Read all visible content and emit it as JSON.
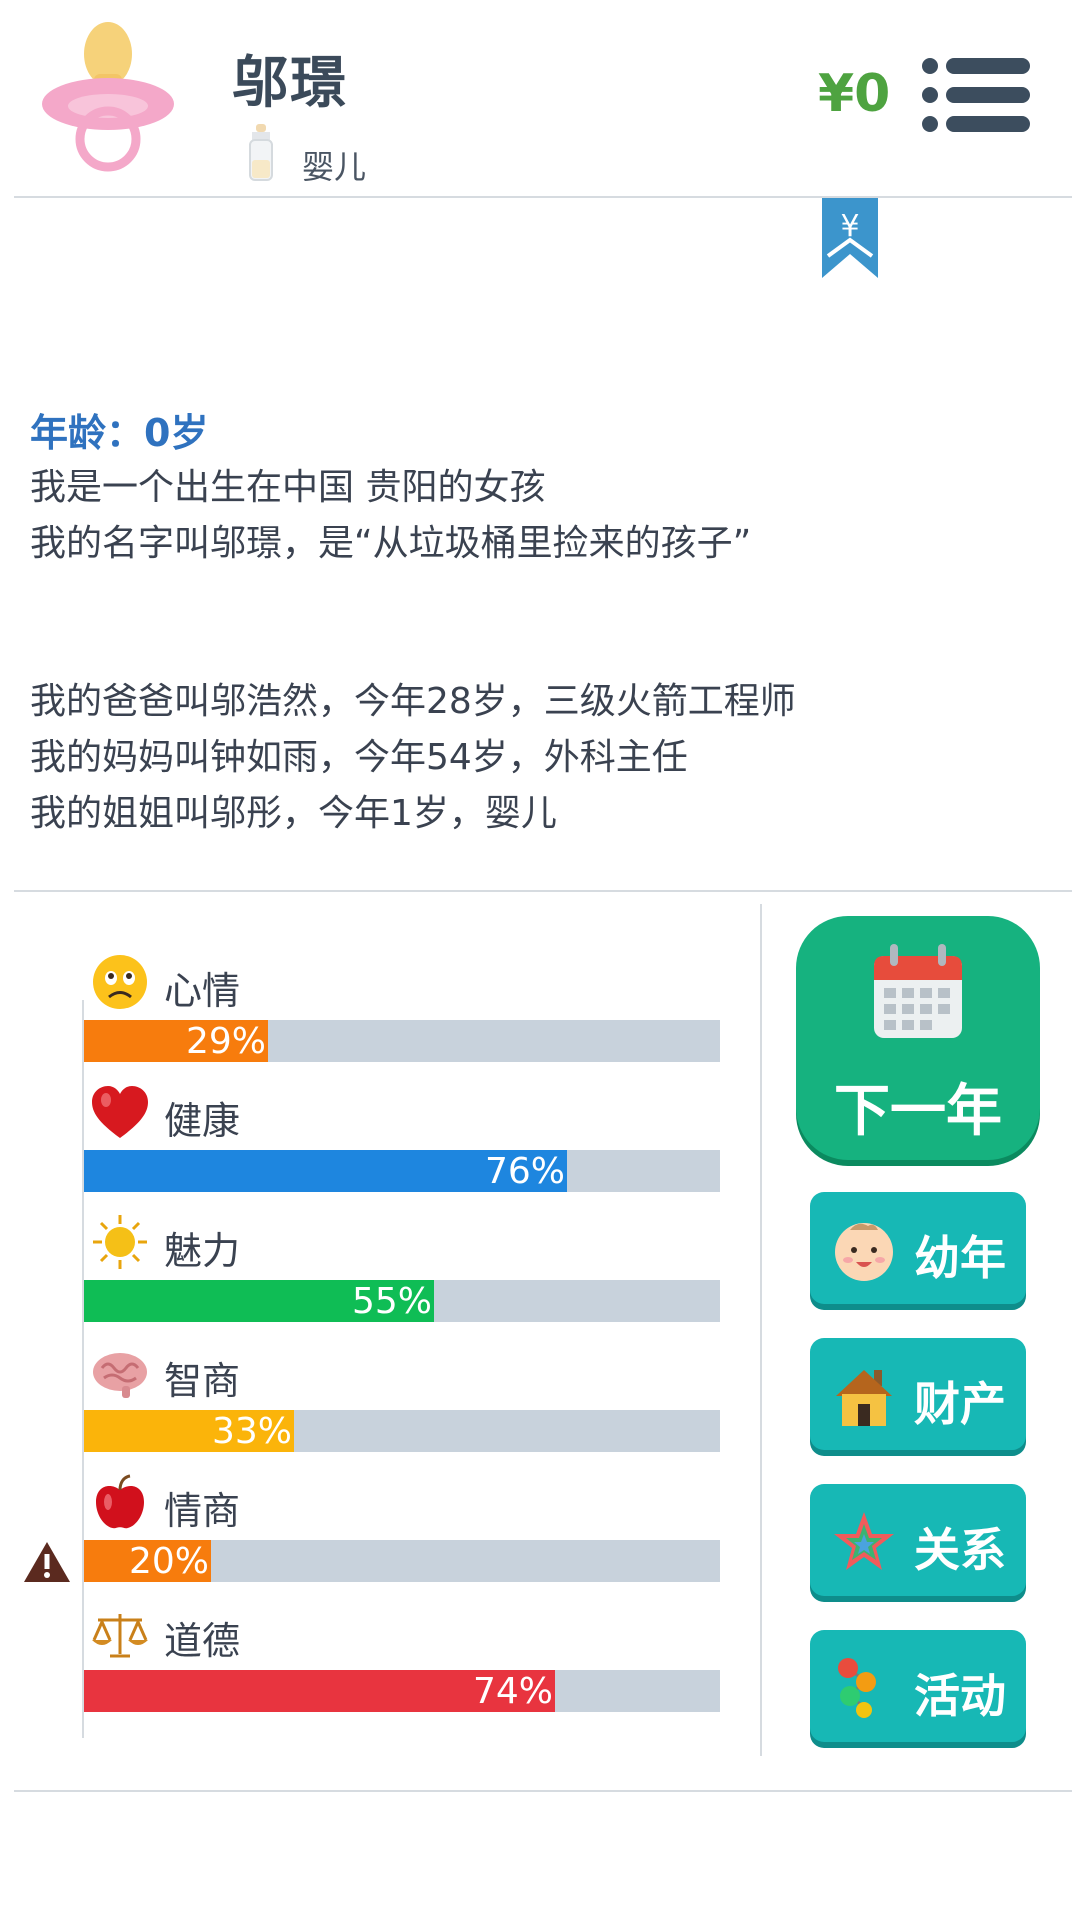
{
  "header": {
    "name": "邬璟",
    "stage": "婴儿",
    "money": "¥0"
  },
  "bookmark_symbol": "¥",
  "story": {
    "age": "年龄：0岁",
    "lines": [
      "我是一个出生在中国 贵阳的女孩",
      "我的名字叫邬璟，是“从垃圾桶里捡来的孩子”",
      "我的爸爸叫邬浩然，今年28岁，三级火箭工程师",
      "我的妈妈叫钟如雨，今年54岁，外科主任",
      "我的姐姐叫邬彤，今年1岁，婴儿"
    ]
  },
  "stats": [
    {
      "label": "心情",
      "pct_text": "29%",
      "value": 0.29,
      "color": "#f77c0d",
      "icon": "sad-face-icon"
    },
    {
      "label": "健康",
      "pct_text": "76%",
      "value": 0.76,
      "color": "#1e86df",
      "icon": "heart-icon"
    },
    {
      "label": "魅力",
      "pct_text": "55%",
      "value": 0.55,
      "color": "#0fbd55",
      "icon": "sun-icon"
    },
    {
      "label": "智商",
      "pct_text": "33%",
      "value": 0.33,
      "color": "#fbb40a",
      "icon": "brain-icon"
    },
    {
      "label": "情商",
      "pct_text": "20%",
      "value": 0.2,
      "color": "#f77c0d",
      "icon": "apple-icon"
    },
    {
      "label": "道德",
      "pct_text": "74%",
      "value": 0.74,
      "color": "#e8343f",
      "icon": "scales-icon"
    }
  ],
  "buttons": {
    "next_year": "下一年",
    "childhood": "幼年",
    "assets": "财产",
    "relations": "关系",
    "activities": "活动"
  },
  "colors": {
    "accent_green": "#16b27f",
    "teal_button": "#17b8b5",
    "money_green": "#4ea340",
    "age_blue": "#2f72bf"
  }
}
